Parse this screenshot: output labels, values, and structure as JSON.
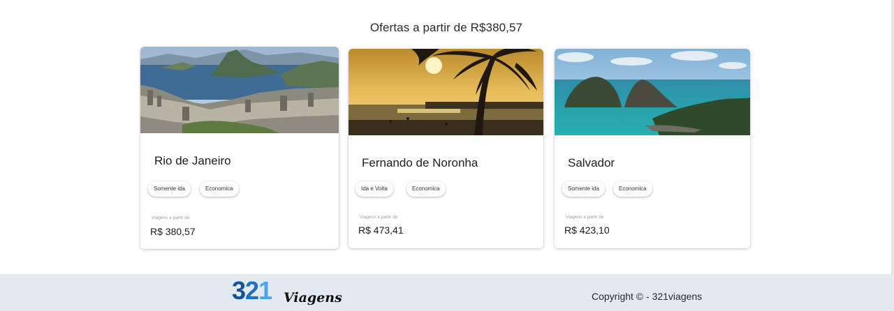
{
  "section": {
    "title": "Ofertas a partir de R$380,57"
  },
  "cards": [
    {
      "city": "Rio de Janeiro",
      "tags": [
        "Somente ida",
        "Economica"
      ],
      "from_label": "Viagens a partir de",
      "price": "R$ 380,57",
      "image": "rio-de-janeiro-photo"
    },
    {
      "city": "Fernando de Noronha",
      "tags": [
        "Ida e Volta",
        "Economica"
      ],
      "from_label": "Viagens a partir de",
      "price": "R$ 473,41",
      "image": "beach-sunset-photo"
    },
    {
      "city": "Salvador",
      "tags": [
        "Somente ida",
        "Economica"
      ],
      "from_label": "Viagens a partir de",
      "price": "R$ 423,10",
      "image": "sea-islands-photo"
    }
  ],
  "footer": {
    "logo": {
      "number": "321",
      "digits": [
        "3",
        "2",
        "1"
      ],
      "word": "Viagens"
    },
    "copyright": "Copyright © - 321viagens"
  },
  "colors": {
    "footer_bg": "#e2e9f0",
    "logo_dark": "#14539c",
    "logo_mid": "#1f6fc4",
    "logo_light": "#4aa6e8"
  }
}
